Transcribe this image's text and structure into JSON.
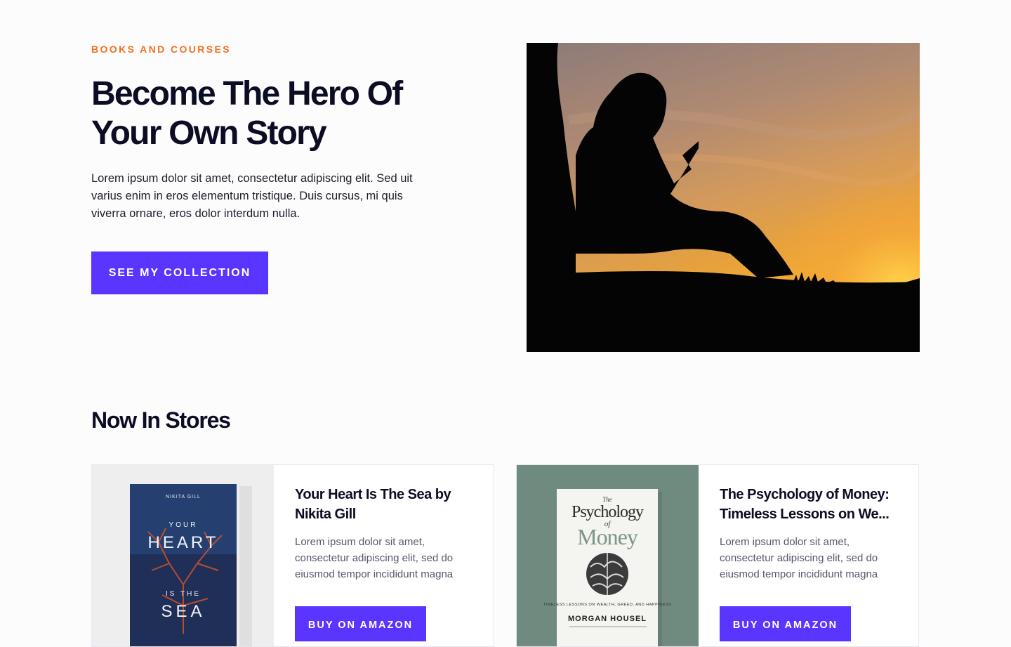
{
  "hero": {
    "eyebrow": "BOOKS AND COURSES",
    "title_line1": "Become The Hero Of",
    "title_line2": "Your Own Story",
    "text": "Lorem ipsum dolor sit amet, consectetur adipiscing elit. Sed uit varius enim in eros elementum tristique. Duis cursus, mi quis viverra ornare, eros dolor interdum nulla.",
    "button_label": "SEE MY COLLECTION",
    "image": "silhouette-boy-reading-at-sunset"
  },
  "section": {
    "title": "Now In Stores"
  },
  "products": [
    {
      "title_line1": "Your Heart Is The Sea by",
      "title_line2": "Nikita Gill",
      "description": "Lorem ipsum dolor sit amet, consectetur adipiscing elit, sed do eiusmod tempor incididunt magna",
      "button_label": "BUY ON AMAZON",
      "cover": {
        "author": "NIKITA GILL",
        "line1": "YOUR",
        "line2": "HEART",
        "line3": "IS THE",
        "line4": "SEA"
      }
    },
    {
      "title_line1": "The Psychology of Money:",
      "title_line2": "Timeless Lessons on We...",
      "description": "Lorem ipsum dolor sit amet, consectetur adipiscing elit, sed do eiusmod tempor incididunt magna",
      "button_label": "BUY ON AMAZON",
      "cover": {
        "the": "The",
        "word1": "Psychology",
        "of": "of",
        "word2": "Money",
        "subtitle": "TIMELESS LESSONS ON WEALTH, GREED, AND HAPPINESS",
        "author": "MORGAN HOUSEL"
      }
    }
  ],
  "colors": {
    "accent": "#5a34ff",
    "eyebrow": "#f0701f",
    "heading": "#0c0c24"
  }
}
